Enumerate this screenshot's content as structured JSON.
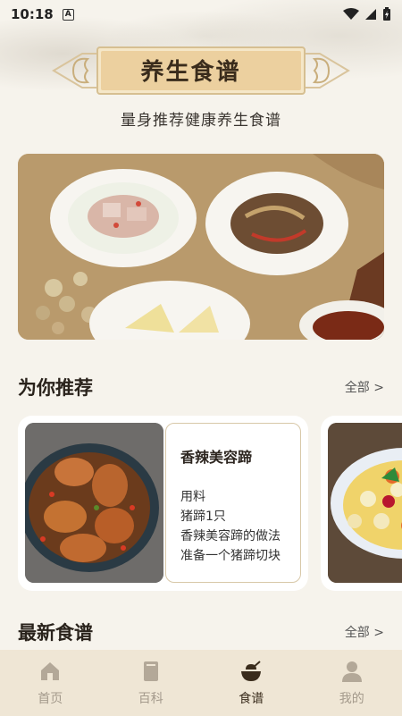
{
  "status": {
    "time": "10:18",
    "notify_letter": "A"
  },
  "header": {
    "title": "养生食谱",
    "subtitle": "量身推荐健康养生食谱"
  },
  "recommend": {
    "title": "为你推荐",
    "more": "全部 >",
    "cards": [
      {
        "name": "香辣美容蹄",
        "lines": [
          "用料",
          "猪蹄1只",
          "香辣美容蹄的做法",
          "准备一个猪蹄切块"
        ]
      }
    ]
  },
  "latest": {
    "title": "最新食谱",
    "more": "全部 >"
  },
  "nav": {
    "items": [
      {
        "label": "首页",
        "icon": "home-icon"
      },
      {
        "label": "百科",
        "icon": "book-icon"
      },
      {
        "label": "食谱",
        "icon": "bowl-icon",
        "active": true
      },
      {
        "label": "我的",
        "icon": "user-icon"
      }
    ]
  },
  "colors": {
    "plaque": "#eccf9f",
    "nav_bg": "#efe6d5",
    "active": "#3a2c1c",
    "inactive": "#a49a8c"
  }
}
